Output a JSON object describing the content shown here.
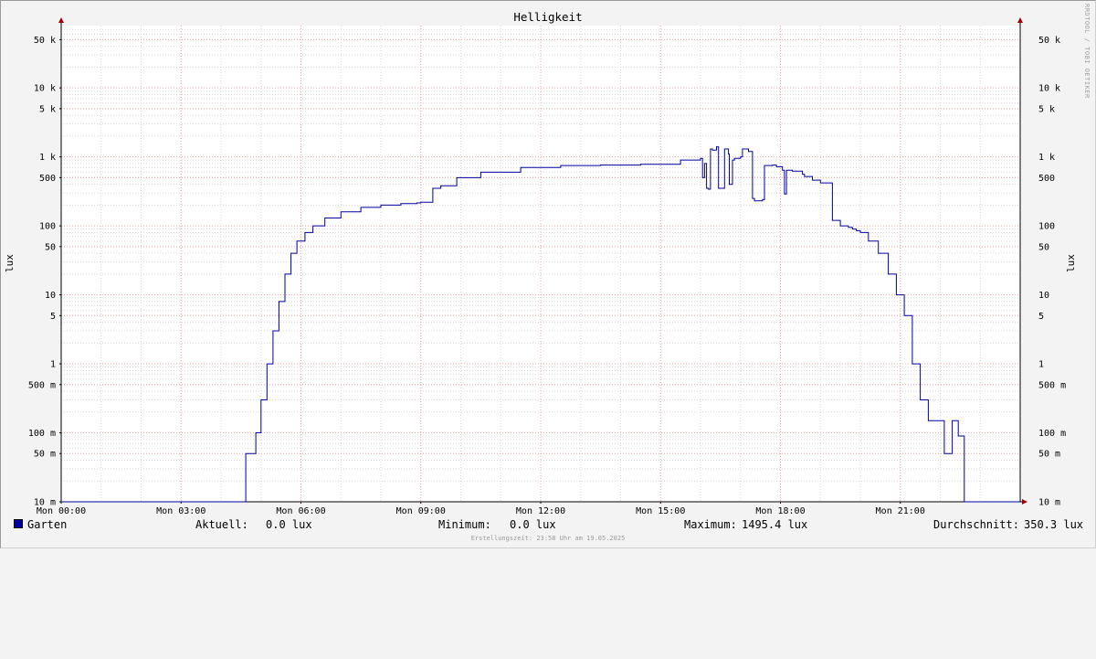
{
  "watermark": "RRDTOOL / TOBI OETIKER",
  "footer": "Erstellungszeit: 23:58 Uhr am 19.05.2025",
  "legend": {
    "series_name": "Garten",
    "series_color": "#0000a0",
    "current_label": "Aktuell:",
    "current_value": "0.0 lux",
    "min_label": "Minimum:",
    "min_value": "0.0 lux",
    "max_label": "Maximum:",
    "max_value": "1495.4 lux",
    "avg_label": "Durchschnitt:",
    "avg_value": "350.3 lux"
  },
  "chart_data": {
    "type": "line",
    "title": "Helligkeit",
    "xlabel": "",
    "ylabel": "lux",
    "y_scale": "log",
    "ylim": [
      0.01,
      80000
    ],
    "xlim": [
      0,
      24
    ],
    "x_ticks": [
      {
        "value": 0,
        "label": "Mon 00:00"
      },
      {
        "value": 3,
        "label": "Mon 03:00"
      },
      {
        "value": 6,
        "label": "Mon 06:00"
      },
      {
        "value": 9,
        "label": "Mon 09:00"
      },
      {
        "value": 12,
        "label": "Mon 12:00"
      },
      {
        "value": 15,
        "label": "Mon 15:00"
      },
      {
        "value": 18,
        "label": "Mon 18:00"
      },
      {
        "value": 21,
        "label": "Mon 21:00"
      }
    ],
    "y_ticks": [
      {
        "value": 0.01,
        "label": "10 m"
      },
      {
        "value": 0.05,
        "label": "50 m"
      },
      {
        "value": 0.1,
        "label": "100 m"
      },
      {
        "value": 0.5,
        "label": "500 m"
      },
      {
        "value": 1,
        "label": "1"
      },
      {
        "value": 5,
        "label": "5"
      },
      {
        "value": 10,
        "label": "10"
      },
      {
        "value": 50,
        "label": "50"
      },
      {
        "value": 100,
        "label": "100"
      },
      {
        "value": 500,
        "label": "500"
      },
      {
        "value": 1000,
        "label": "1 k"
      },
      {
        "value": 5000,
        "label": "5 k"
      },
      {
        "value": 10000,
        "label": "10 k"
      },
      {
        "value": 50000,
        "label": "50 k"
      }
    ],
    "grid": true,
    "series": [
      {
        "name": "Garten",
        "color": "#0000a0",
        "x": [
          0,
          4.6,
          4.62,
          4.85,
          4.87,
          5.0,
          5.15,
          5.3,
          5.45,
          5.6,
          5.75,
          5.9,
          6.1,
          6.3,
          6.6,
          7.0,
          7.5,
          8.0,
          8.5,
          8.9,
          9.0,
          9.3,
          9.5,
          9.9,
          10.5,
          11.5,
          12.5,
          13.5,
          14.5,
          15.5,
          16.0,
          16.05,
          16.1,
          16.15,
          16.2,
          16.25,
          16.3,
          16.4,
          16.45,
          16.6,
          16.7,
          16.72,
          16.8,
          16.85,
          17.0,
          17.05,
          17.2,
          17.3,
          17.35,
          17.55,
          17.6,
          17.8,
          17.9,
          18.05,
          18.1,
          18.15,
          18.3,
          18.55,
          18.6,
          18.8,
          19.0,
          19.3,
          19.5,
          19.7,
          19.8,
          19.9,
          20.0,
          20.2,
          20.45,
          20.7,
          20.9,
          21.1,
          21.3,
          21.5,
          21.7,
          21.9,
          22.1,
          22.2,
          22.3,
          22.42,
          22.45,
          22.55,
          22.6,
          22.62,
          22.75,
          22.77,
          22.85,
          22.88,
          22.9,
          24
        ],
        "values": [
          0.01,
          0.01,
          0.05,
          0.05,
          0.1,
          0.3,
          1,
          3,
          8,
          20,
          40,
          60,
          80,
          100,
          130,
          160,
          185,
          200,
          210,
          215,
          220,
          350,
          380,
          500,
          600,
          700,
          750,
          760,
          780,
          900,
          950,
          500,
          800,
          350,
          340,
          1300,
          1250,
          1400,
          350,
          1300,
          1100,
          400,
          900,
          950,
          1000,
          1300,
          1200,
          250,
          230,
          240,
          750,
          760,
          720,
          640,
          290,
          640,
          620,
          560,
          520,
          460,
          420,
          120,
          100,
          95,
          90,
          85,
          80,
          60,
          40,
          20,
          10,
          5,
          1,
          0.3,
          0.15,
          0.15,
          0.05,
          0.05,
          0.15,
          0.15,
          0.09,
          0.09,
          0.01,
          0.01,
          0.01,
          0.01,
          0.01,
          0.01,
          0.01,
          0.01
        ]
      }
    ]
  }
}
